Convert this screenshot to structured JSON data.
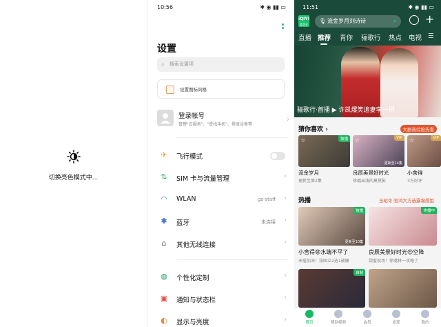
{
  "pane1": {
    "status_text": "切换亮色模式中..."
  },
  "pane2": {
    "status_time": "10:56",
    "status_icons": "✱ ◉ ▮▮ ▭",
    "title": "设置",
    "search_placeholder": "搜索设置项",
    "theme_card": "设置图标风格",
    "account": {
      "name": "登录帐号",
      "desc": "管理\"云服务\"、\"查找手机\"、登录设备等"
    },
    "rows": [
      {
        "icon": "airplane-icon",
        "label": "飞行模式",
        "value": "",
        "color": "#e8a54b"
      },
      {
        "icon": "sim-card-icon",
        "label": "SIM 卡与流量管理",
        "value": "",
        "color": "#2eaf6b"
      },
      {
        "icon": "wifi-icon",
        "label": "WLAN",
        "value": "gz-staff",
        "color": "#3b82c4"
      },
      {
        "icon": "bluetooth-icon",
        "label": "蓝牙",
        "value": "未连接",
        "color": "#3b6fd4"
      },
      {
        "icon": "wireless-icon",
        "label": "其他无线连接",
        "value": "",
        "color": "#666666"
      },
      {
        "icon": "palette-icon",
        "label": "个性化定制",
        "value": "",
        "color": "#27a56a"
      },
      {
        "icon": "notification-icon",
        "label": "通知与状态栏",
        "value": "",
        "color": "#d9544b"
      },
      {
        "icon": "brightness-icon",
        "label": "显示与亮度",
        "value": "",
        "color": "#e8893b"
      }
    ]
  },
  "pane3": {
    "status_time": "11:51",
    "status_icons": "✱ ◉ ▮▮ ▭",
    "logo": "iQIYI",
    "logo_sub": "爱奇艺",
    "search_text": "流金岁月刘诗诗",
    "tabs": [
      "直播",
      "推荐",
      "青你",
      "骊歌行",
      "热点",
      "电视"
    ],
    "active_tab": "推荐",
    "banner_caption": "骊歌行·首播 ▶ 许凯爆笑追妻李一桐",
    "guess": {
      "title": "猜你喜欢 ›",
      "pill": "大剧热综抢先看",
      "items": [
        {
          "title": "流金岁月",
          "sub": "更新至第2集",
          "badge": "独播",
          "badge_color": "#1fb35e"
        },
        {
          "title": "良辰美景好时光",
          "sub": "徐璐出演的莫黛影",
          "badge": "VIP",
          "badge_color": "#d4a752",
          "extra": "更新至14集"
        },
        {
          "title": "小舍得",
          "sub": "3万好评",
          "badge": "VIP",
          "badge_color": "#d4a752"
        }
      ]
    },
    "hot": {
      "title": "热播",
      "pill": "玉昭令·官鸿大方选露霜想型",
      "items": [
        {
          "title": "小舍得😧水端不平了",
          "sub": "矛盾加深！张国立2选1被嫌",
          "badge": "独播",
          "badge_color": "#1fb35e",
          "extra": "更新至10集"
        },
        {
          "title": "良辰美景好时光😍空降",
          "sub": "甜蜜现场！徐璐林一攻略了",
          "badge": "热播中",
          "badge_color": "#1fb35e"
        }
      ]
    },
    "bottom_badge": "自制",
    "nav": [
      {
        "label": "首页",
        "active": true
      },
      {
        "label": "随刻视频",
        "active": false
      },
      {
        "label": "会员",
        "active": false
      },
      {
        "label": "发现",
        "active": false
      },
      {
        "label": "我的",
        "active": false
      }
    ]
  }
}
